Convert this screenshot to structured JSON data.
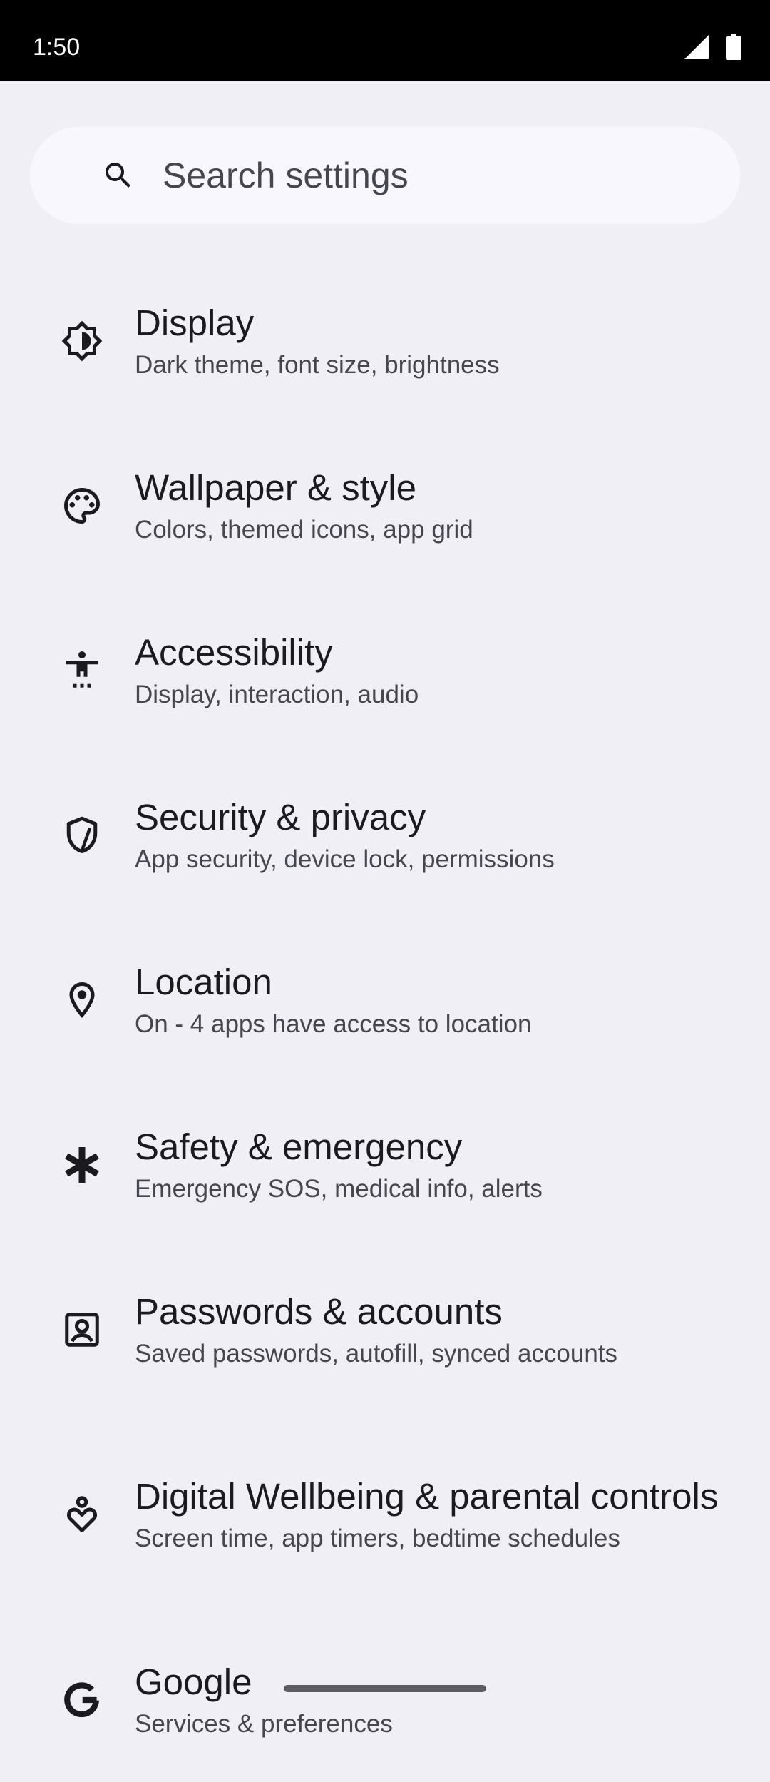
{
  "status_bar": {
    "time": "1:50",
    "icons": [
      "signal-icon",
      "battery-icon"
    ]
  },
  "search": {
    "placeholder": "Search settings",
    "icon": "search-icon"
  },
  "items": [
    {
      "title": "Display",
      "subtitle": "Dark theme, font size, brightness",
      "icon": "display-brightness-icon"
    },
    {
      "title": "Wallpaper & style",
      "subtitle": "Colors, themed icons, app grid",
      "icon": "palette-icon"
    },
    {
      "title": "Accessibility",
      "subtitle": "Display, interaction, audio",
      "icon": "accessibility-icon"
    },
    {
      "title": "Security & privacy",
      "subtitle": "App security, device lock, permissions",
      "icon": "shield-icon"
    },
    {
      "title": "Location",
      "subtitle": "On - 4 apps have access to location",
      "icon": "location-pin-icon"
    },
    {
      "title": "Safety & emergency",
      "subtitle": "Emergency SOS, medical info, alerts",
      "icon": "asterisk-icon"
    },
    {
      "title": "Passwords & accounts",
      "subtitle": "Saved passwords, autofill, synced accounts",
      "icon": "account-box-icon"
    },
    {
      "title": "Digital Wellbeing & parental controls",
      "subtitle": "Screen time, app timers, bedtime schedules",
      "icon": "wellbeing-icon"
    },
    {
      "title": "Google",
      "subtitle": "Services & preferences",
      "icon": "google-icon"
    }
  ],
  "colors": {
    "background": "#f0eff6",
    "search_background": "#f8f7fd",
    "status_bar": "#000000",
    "title_text": "#1b1b1f",
    "subtitle_text": "#46464f"
  }
}
